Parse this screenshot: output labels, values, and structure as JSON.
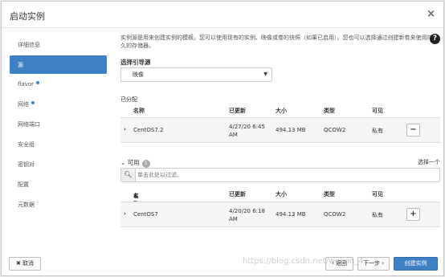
{
  "modal": {
    "title": "启动实例",
    "close": "×"
  },
  "sidebar": {
    "items": [
      {
        "label": "详细信息"
      },
      {
        "label": "源"
      },
      {
        "label": "flavor"
      },
      {
        "label": "网络"
      },
      {
        "label": "网络端口"
      },
      {
        "label": "安全组"
      },
      {
        "label": "密钥对"
      },
      {
        "label": "配置"
      },
      {
        "label": "元数据"
      }
    ]
  },
  "source": {
    "description": "实例源是用来创建实例的模板。您可以使用现有的实例、映像或卷的快照（如果已启用）。您也可以选择通过创建新卷来使用持久的存储器。",
    "help": "?",
    "boot_source_label": "选择引导源",
    "boot_source_value": "映像",
    "allocated_label": "已分配",
    "available_label": "可用",
    "available_count": "1",
    "select_one": "选择一个",
    "filter_placeholder": "单击此处以过滤。",
    "columns": {
      "name": "名称",
      "updated": "已更新",
      "size": "大小",
      "type": "类型",
      "visibility": "可见"
    },
    "sort_indicator": "▲",
    "allocated_rows": [
      {
        "name": "CentOS7.2",
        "updated": "4/27/20 6:45 AM",
        "size": "494.13 MB",
        "type": "QCOW2",
        "visibility": "私有",
        "action": "−"
      }
    ],
    "available_rows": [
      {
        "name": "CentOS7",
        "updated": "4/20/20 6:18 AM",
        "size": "494.13 MB",
        "type": "QCOW2",
        "visibility": "私有",
        "action": "+"
      }
    ]
  },
  "footer": {
    "cancel": "✖ 取消",
    "back": "‹ 返回",
    "next": "下一步 ›",
    "create": "创建实例"
  },
  "watermark": "https://blog.csdn.net/weixin_4..."
}
